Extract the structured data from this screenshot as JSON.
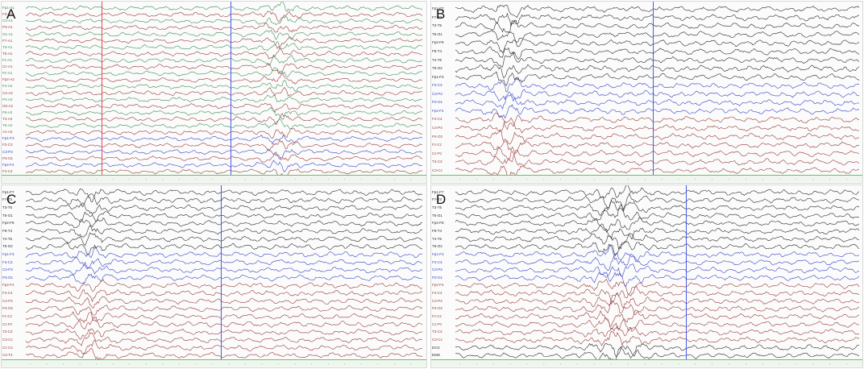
{
  "figure": {
    "colors": {
      "black_trace": "#2b2b2b",
      "red_trace": "#9a3b3b",
      "blue_trace": "#3b45c8",
      "green_trace": "#3f8f5a",
      "cursor_blue": "#4a5ae8",
      "cursor_red": "#e05050",
      "timebar_green": "#2a8a2a"
    },
    "panels": [
      {
        "id": "A",
        "letter": "A",
        "channels": 26,
        "pattern": [
          "green",
          "red",
          "green",
          "red",
          "green",
          "red",
          "green",
          "red",
          "green",
          "red",
          "green",
          "red",
          "green",
          "red",
          "green",
          "red",
          "green",
          "red",
          "green",
          "red",
          "blue",
          "red",
          "blue",
          "red",
          "blue",
          "red"
        ],
        "labels": [
          "Fp1-A1",
          "F3-A1",
          "C3-A1",
          "P3-A1",
          "O1-A1",
          "F7-A1",
          "T3-A1",
          "T5-A1",
          "Fz-A1",
          "Cz-A1",
          "Pz-A1",
          "Fp2-A2",
          "F4-A2",
          "C4-A2",
          "P4-A2",
          "O2-A2",
          "F8-A2",
          "T4-A2",
          "T6-A2",
          "A1-A2",
          "Fp1-F3",
          "F3-C3",
          "C3-P3",
          "P3-O1",
          "Fp2-F4",
          "F4-C4"
        ],
        "cursors": [
          {
            "color_key": "cursor_red",
            "pos": 0.19
          },
          {
            "color_key": "cursor_blue",
            "pos": 0.515
          }
        ],
        "burst": {
          "center": 0.64,
          "width": 0.04,
          "amp": 3.0
        }
      },
      {
        "id": "B",
        "letter": "B",
        "channels": 20,
        "pattern": [
          "black",
          "black",
          "black",
          "black",
          "black",
          "black",
          "black",
          "black",
          "black",
          "blue",
          "blue",
          "blue",
          "blue",
          "red",
          "red",
          "red",
          "red",
          "red",
          "red",
          "red"
        ],
        "labels": [
          "Fp1-F7",
          "F7-T3",
          "T3-T5",
          "T5-O1",
          "Fp2-F8",
          "F8-T4",
          "T4-T6",
          "T6-O2",
          "Fp1-F3",
          "F3-C3",
          "C3-P3",
          "P3-O1",
          "Fp2-F4",
          "F4-C4",
          "C4-P4",
          "P4-O2",
          "Fz-Cz",
          "Cz-Pz",
          "T3-C3",
          "C3-Cz"
        ],
        "cursors": [
          {
            "color_key": "cursor_blue",
            "pos": 0.49
          }
        ],
        "burst": {
          "center": 0.13,
          "width": 0.035,
          "amp": 3.5
        }
      },
      {
        "id": "C",
        "letter": "C",
        "channels": 22,
        "pattern": [
          "black",
          "black",
          "black",
          "black",
          "black",
          "black",
          "black",
          "black",
          "blue",
          "blue",
          "blue",
          "blue",
          "red",
          "red",
          "red",
          "red",
          "red",
          "red",
          "red",
          "red",
          "red",
          "red"
        ],
        "labels": [
          "Fp1-F7",
          "F7-T3",
          "T3-T5",
          "T5-O1",
          "Fp2-F8",
          "F8-T4",
          "T4-T6",
          "T6-O2",
          "Fp1-F3",
          "F3-C3",
          "C3-P3",
          "P3-O1",
          "Fp2-F4",
          "F4-C4",
          "C4-P4",
          "P4-O2",
          "Fz-Cz",
          "Cz-Pz",
          "T3-C3",
          "C3-Cz",
          "Cz-C4",
          "C4-T4"
        ],
        "cursors": [
          {
            "color_key": "cursor_blue",
            "pos": 0.49
          }
        ],
        "burst": {
          "center": 0.16,
          "width": 0.04,
          "amp": 3.0
        }
      },
      {
        "id": "D",
        "letter": "D",
        "channels": 22,
        "pattern": [
          "black",
          "black",
          "black",
          "black",
          "black",
          "black",
          "black",
          "black",
          "blue",
          "blue",
          "blue",
          "blue",
          "red",
          "red",
          "red",
          "red",
          "red",
          "red",
          "red",
          "red",
          "black",
          "black"
        ],
        "labels": [
          "Fp1-F7",
          "F7-T3",
          "T3-T5",
          "T5-O1",
          "Fp2-F8",
          "F8-T4",
          "T4-T6",
          "T6-O2",
          "Fp1-F3",
          "F3-C3",
          "C3-P3",
          "P3-O1",
          "Fp2-F4",
          "F4-C4",
          "C4-P4",
          "P4-O2",
          "Fz-Cz",
          "Cz-Pz",
          "T3-C3",
          "C3-Cz",
          "ECG",
          "EMG"
        ],
        "cursors": [
          {
            "color_key": "cursor_blue",
            "pos": 0.57
          }
        ],
        "burst": {
          "center": 0.4,
          "width": 0.06,
          "amp": 3.5
        }
      }
    ]
  }
}
